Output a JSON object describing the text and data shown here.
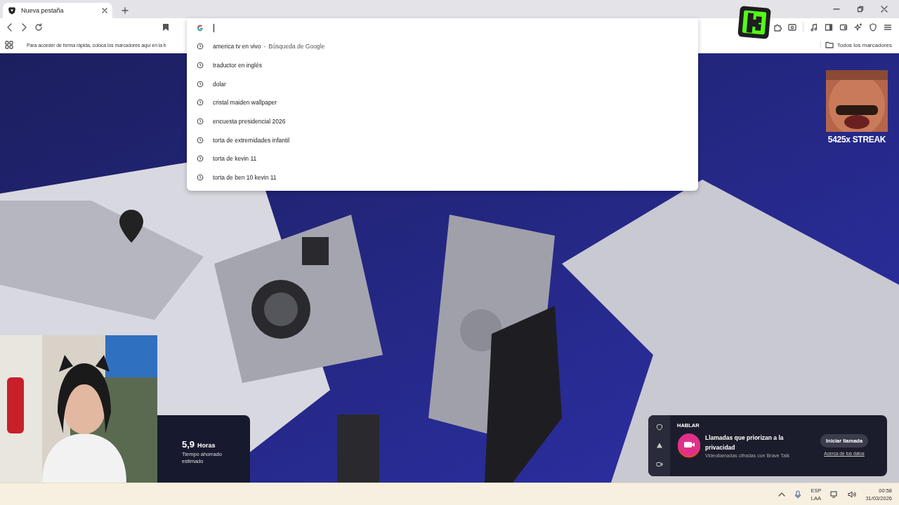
{
  "tab": {
    "title": "Nueva pestaña",
    "selected": true
  },
  "bookmarks_bar": {
    "hint": "Para acceder de forma rápida, coloca los marcadores aquí en la b",
    "all_bookmarks": "Todos los marcadores"
  },
  "suggestions": [
    {
      "text": "america tv en vivo",
      "separator": "-",
      "detail": "Búsqueda de Google"
    },
    {
      "text": "traductor en inglés"
    },
    {
      "text": "dolar"
    },
    {
      "text": "cristal maiden wallpaper"
    },
    {
      "text": "encuesta presidencial 2026"
    },
    {
      "text": "torta de extremidades infantil"
    },
    {
      "text": "torta de kevin 11"
    },
    {
      "text": "torta de ben 10 kevin 11"
    }
  ],
  "overlay": {
    "streak": "5425x STREAK"
  },
  "stats": {
    "value": "5,9",
    "unit": "Horas",
    "label": "Tiempo ahorrado estimado"
  },
  "talk_widget": {
    "heading": "HABLAR",
    "title": "Llamadas que priorizan a la privacidad",
    "subtitle": "Videollamadas cifradas con Brave Talk",
    "button": "Iniciar llamada",
    "link": "Acerca de tus datos"
  },
  "taskbar": {
    "language": "ESP",
    "layout": "LAA",
    "time": "00:58",
    "date": "31/03/2026"
  }
}
